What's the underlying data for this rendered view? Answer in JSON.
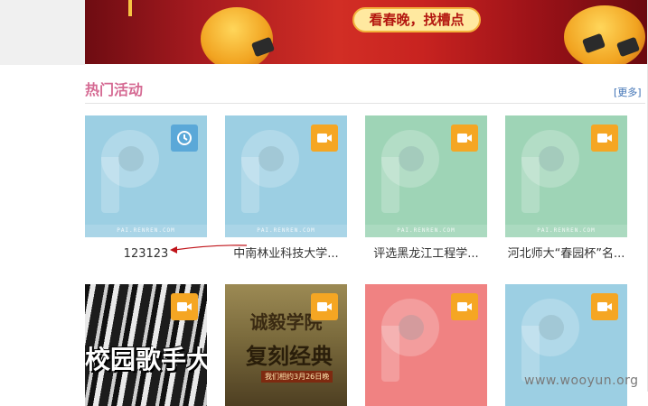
{
  "banner": {
    "caption": "看春晚，找槽点"
  },
  "section": {
    "title": "热门活动",
    "more_link": "[更多]"
  },
  "activities": [
    {
      "caption": "123123",
      "badge": "clock-icon",
      "thumb": "blue",
      "footer": "PAI.RENREN.COM"
    },
    {
      "caption": "中南林业科技大学...",
      "badge": "video-camera-icon",
      "thumb": "blue",
      "footer": "PAI.RENREN.COM"
    },
    {
      "caption": "评选黑龙江工程学...",
      "badge": "video-camera-icon",
      "thumb": "green",
      "footer": "PAI.RENREN.COM"
    },
    {
      "caption": "河北师大“春园杯”名...",
      "badge": "video-camera-icon",
      "thumb": "green",
      "footer": "PAI.RENREN.COM"
    },
    {
      "badge": "video-camera-icon",
      "thumb": "poster",
      "poster_text": "校园歌手大赛"
    },
    {
      "badge": "video-camera-icon",
      "thumb": "poster",
      "poster_text_top": "诚毅学院",
      "poster_text_main": "复刻经典",
      "poster_text_date": "我们相约3月26日晚"
    },
    {
      "badge": "video-camera-icon",
      "thumb": "red"
    },
    {
      "badge": "video-camera-icon",
      "thumb": "blue"
    }
  ],
  "watermark": "www.wooyun.org",
  "colors": {
    "section_title": "#d56a93",
    "link": "#3f72b5",
    "video_badge": "#f5a623",
    "clock_badge": "#5aa8d8",
    "thumb_blue": "#9ccfe3",
    "thumb_green": "#9ed4b6",
    "thumb_red": "#f08282"
  }
}
